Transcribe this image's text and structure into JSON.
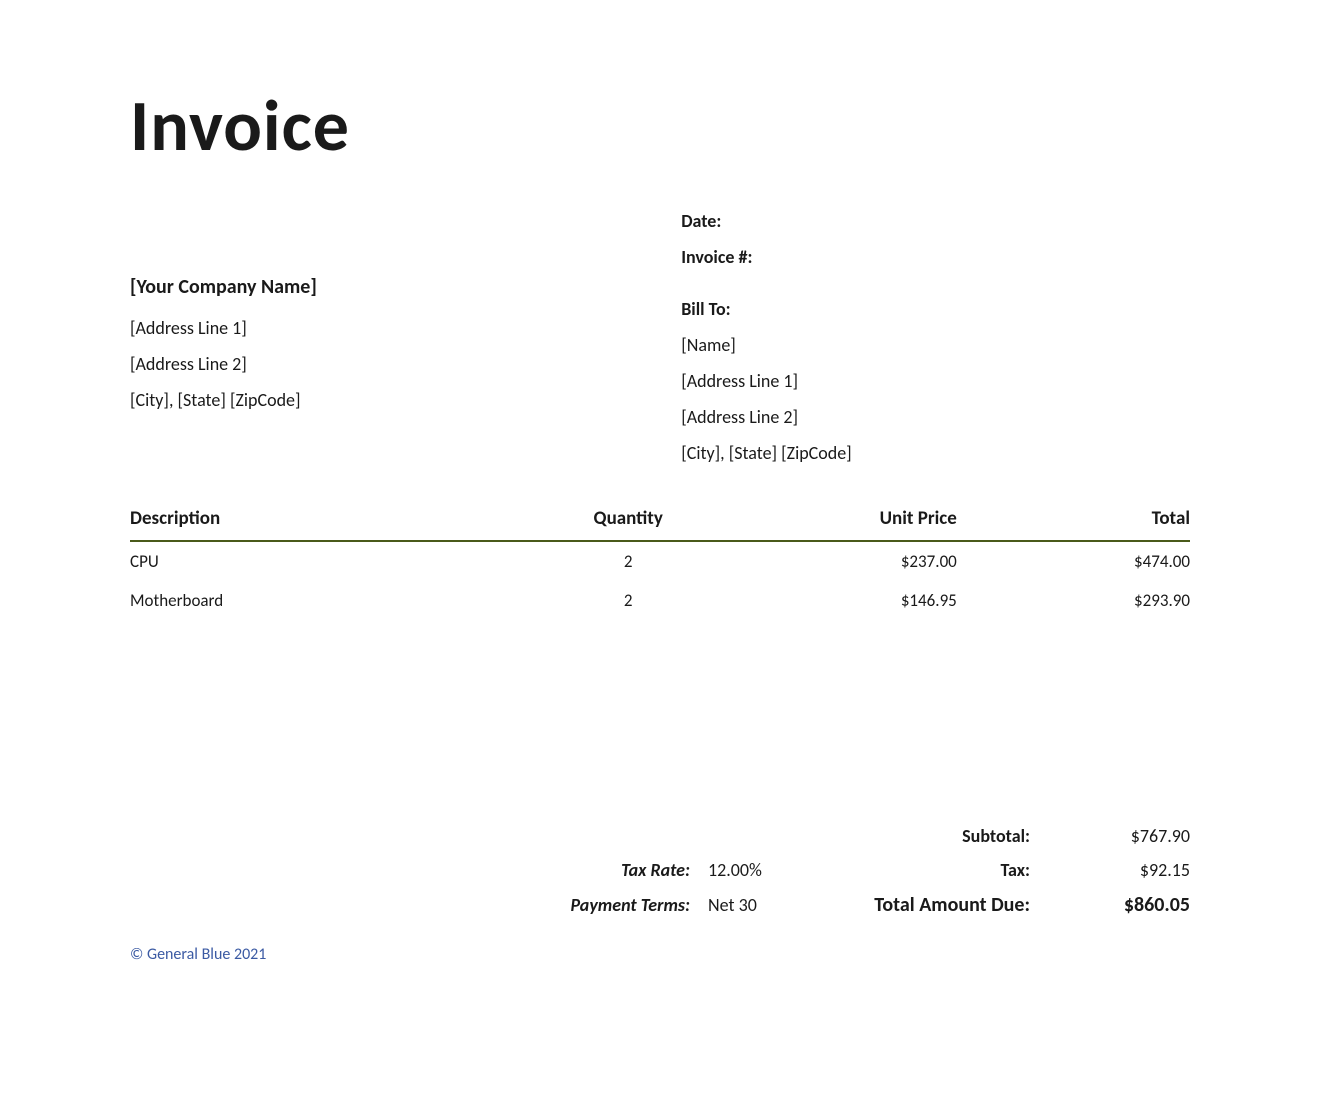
{
  "title": "Invoice",
  "meta": {
    "date_label": "Date:",
    "date_value": "",
    "invoice_num_label": "Invoice #:",
    "invoice_num_value": ""
  },
  "from": {
    "company": "[Your Company Name]",
    "address1": "[Address Line 1]",
    "address2": "[Address Line 2]",
    "city_state_zip": "[City], [State] [ZipCode]"
  },
  "bill_to": {
    "label": "Bill To:",
    "name": "[Name]",
    "address1": "[Address Line 1]",
    "address2": "[Address Line 2]",
    "city_state_zip": "[City], [State] [ZipCode]"
  },
  "table": {
    "headers": {
      "description": "Description",
      "quantity": "Quantity",
      "unit_price": "Unit Price",
      "total": "Total"
    },
    "rows": [
      {
        "description": "CPU",
        "quantity": "2",
        "unit_price": "$237.00",
        "total": "$474.00"
      },
      {
        "description": "Motherboard",
        "quantity": "2",
        "unit_price": "$146.95",
        "total": "$293.90"
      }
    ]
  },
  "summary": {
    "tax_rate_label": "Tax Rate:",
    "tax_rate_value": "12.00%",
    "payment_terms_label": "Payment Terms:",
    "payment_terms_value": "Net 30",
    "subtotal_label": "Subtotal:",
    "subtotal_value": "$767.90",
    "tax_label": "Tax:",
    "tax_value": "$92.15",
    "total_due_label": "Total Amount Due:",
    "total_due_value": "$860.05"
  },
  "footer": "© General Blue 2021"
}
